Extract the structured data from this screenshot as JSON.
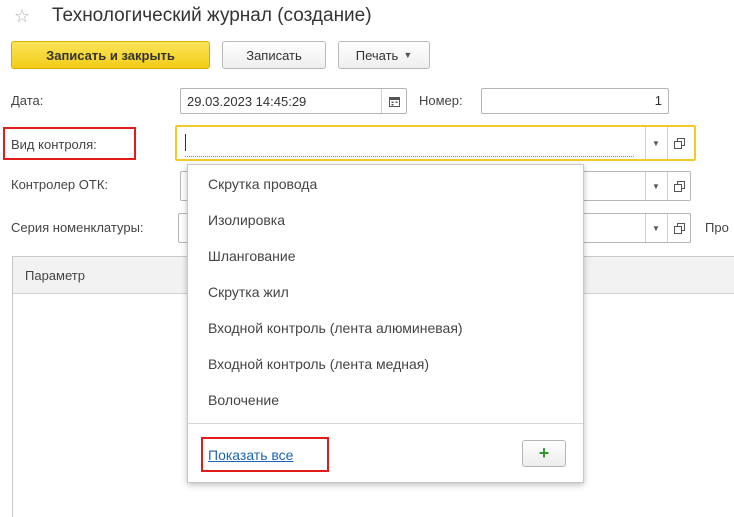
{
  "header": {
    "title": "Технологический журнал (создание)",
    "star_icon": "star-icon"
  },
  "toolbar": {
    "save_close_label": "Записать и закрыть",
    "save_label": "Записать",
    "print_label": "Печать"
  },
  "form": {
    "date_label": "Дата:",
    "date_value": "29.03.2023 14:45:29",
    "number_label": "Номер:",
    "number_value": "1",
    "control_type_label": "Вид контроля:",
    "control_type_value": "",
    "inspector_label": "Контролер ОТК:",
    "series_label": "Серия номенклатуры:",
    "cut_label": "Про"
  },
  "table": {
    "header": "Параметр"
  },
  "dropdown": {
    "items": [
      "Скрутка провода",
      "Изолировка",
      "Шлангование",
      "Скрутка жил",
      "Входной контроль (лента алюминевая)",
      "Входной контроль (лента медная)",
      "Волочение"
    ],
    "show_all": "Показать все",
    "add_symbol": "+"
  },
  "colors": {
    "accent": "#f2cc16",
    "highlight": "#e41b1b",
    "link": "#1d66b5"
  }
}
